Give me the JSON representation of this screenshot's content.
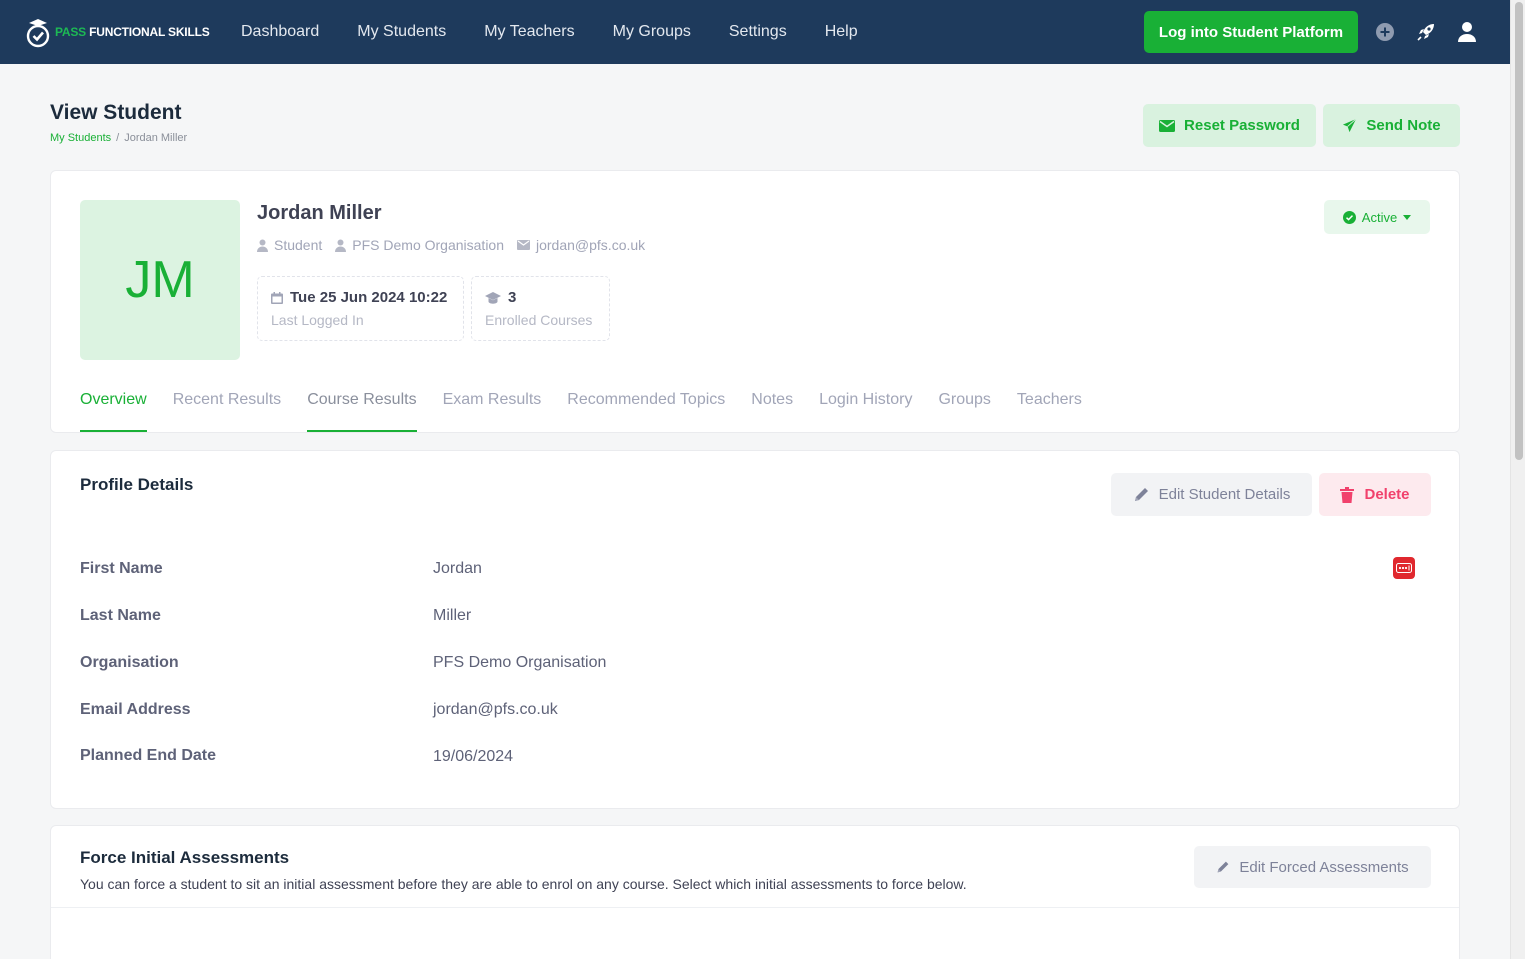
{
  "brand": {
    "pass": "PASS",
    "rest": " FUNCTIONAL SKILLS"
  },
  "nav": {
    "items": [
      "Dashboard",
      "My Students",
      "My Teachers",
      "My Groups",
      "Settings",
      "Help"
    ],
    "login_button": "Log into Student Platform"
  },
  "header": {
    "title": "View Student",
    "breadcrumb": {
      "parent": "My Students",
      "separator": "/",
      "current": "Jordan Miller"
    },
    "reset_password": "Reset Password",
    "send_note": "Send Note"
  },
  "student": {
    "initials": "JM",
    "name": "Jordan Miller",
    "role": "Student",
    "organisation": "PFS Demo Organisation",
    "email": "jordan@pfs.co.uk",
    "last_login": {
      "value": "Tue 25 Jun 2024 10:22",
      "label": "Last Logged In"
    },
    "courses": {
      "value": "3",
      "label": "Enrolled Courses"
    },
    "status": "Active"
  },
  "tabs": [
    "Overview",
    "Recent Results",
    "Course Results",
    "Exam Results",
    "Recommended Topics",
    "Notes",
    "Login History",
    "Groups",
    "Teachers"
  ],
  "profile": {
    "title": "Profile Details",
    "edit_button": "Edit Student Details",
    "delete_button": "Delete",
    "rows": [
      {
        "label": "First Name",
        "value": "Jordan"
      },
      {
        "label": "Last Name",
        "value": "Miller"
      },
      {
        "label": "Organisation",
        "value": "PFS Demo Organisation"
      },
      {
        "label": "Email Address",
        "value": "jordan@pfs.co.uk"
      },
      {
        "label": "Planned End Date",
        "value": "19/06/2024"
      }
    ]
  },
  "force": {
    "title": "Force Initial Assessments",
    "description": "You can force a student to sit an initial assessment before they are able to enrol on any course. Select which initial assessments to force below.",
    "edit_button": "Edit Forced Assessments"
  },
  "colors": {
    "nav_bg": "#1e3a5c",
    "accent": "#19b036",
    "danger": "#f1416c"
  }
}
